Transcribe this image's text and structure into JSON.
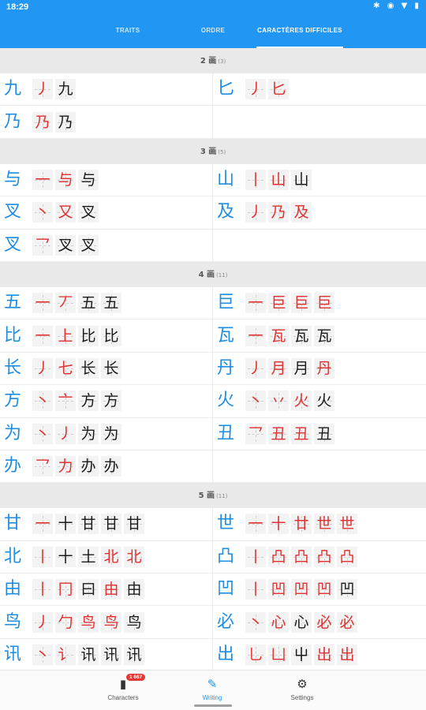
{
  "status": {
    "time": "18:29",
    "icons": "✱ ◉ ▼ ▮"
  },
  "tabs": [
    {
      "label": "TRAITS",
      "active": false
    },
    {
      "label": "ORDRE",
      "active": false
    },
    {
      "label": "CARACTÈRES DIFFICILES",
      "active": true
    }
  ],
  "sections": [
    {
      "title": "2 画",
      "count": "(3)",
      "rows": [
        [
          {
            "char": "九",
            "steps": [
              "丿",
              "九"
            ],
            "red": [
              0
            ]
          },
          {
            "char": "匕",
            "steps": [
              "丿",
              "匕"
            ],
            "red": [
              0,
              1
            ]
          }
        ],
        [
          {
            "char": "乃",
            "steps": [
              "乃",
              "乃"
            ],
            "red": [
              0
            ]
          },
          null
        ]
      ]
    },
    {
      "title": "3 画",
      "count": "(5)",
      "rows": [
        [
          {
            "char": "与",
            "steps": [
              "一",
              "与",
              "与"
            ],
            "red": [
              0,
              1
            ]
          },
          {
            "char": "山",
            "steps": [
              "丨",
              "山",
              "山"
            ],
            "red": [
              0,
              1
            ]
          }
        ],
        [
          {
            "char": "叉",
            "steps": [
              "丶",
              "又",
              "叉"
            ],
            "red": [
              0,
              1
            ]
          },
          {
            "char": "及",
            "steps": [
              "丿",
              "乃",
              "及"
            ],
            "red": [
              0,
              1,
              2
            ]
          }
        ],
        [
          {
            "char": "叉",
            "steps": [
              "乛",
              "叉",
              "叉"
            ],
            "red": [
              0
            ]
          },
          null
        ]
      ]
    },
    {
      "title": "4 画",
      "count": "(11)",
      "rows": [
        [
          {
            "char": "五",
            "steps": [
              "一",
              "丆",
              "五",
              "五"
            ],
            "red": [
              0,
              1
            ]
          },
          {
            "char": "巨",
            "steps": [
              "一",
              "巨",
              "巨",
              "巨"
            ],
            "red": [
              0,
              1,
              2,
              3
            ]
          }
        ],
        [
          {
            "char": "比",
            "steps": [
              "一",
              "上",
              "比",
              "比"
            ],
            "red": [
              0,
              1
            ]
          },
          {
            "char": "瓦",
            "steps": [
              "一",
              "瓦",
              "瓦",
              "瓦"
            ],
            "red": [
              0,
              1
            ]
          }
        ],
        [
          {
            "char": "长",
            "steps": [
              "丿",
              "七",
              "长",
              "长"
            ],
            "red": [
              0,
              1
            ]
          },
          {
            "char": "丹",
            "steps": [
              "丿",
              "月",
              "月",
              "丹"
            ],
            "red": [
              0,
              1,
              3
            ]
          }
        ],
        [
          {
            "char": "方",
            "steps": [
              "丶",
              "亠",
              "方",
              "方"
            ],
            "red": [
              0,
              1
            ]
          },
          {
            "char": "火",
            "steps": [
              "丶",
              "丷",
              "火",
              "火"
            ],
            "red": [
              0,
              1,
              2
            ]
          }
        ],
        [
          {
            "char": "为",
            "steps": [
              "丶",
              "丿",
              "为",
              "为"
            ],
            "red": [
              0,
              1
            ]
          },
          {
            "char": "丑",
            "steps": [
              "乛",
              "丑",
              "丑",
              "丑"
            ],
            "red": [
              0,
              1,
              2
            ]
          }
        ],
        [
          {
            "char": "办",
            "steps": [
              "乛",
              "力",
              "办",
              "办"
            ],
            "red": [
              0,
              1
            ]
          },
          null
        ]
      ]
    },
    {
      "title": "5 画",
      "count": "(11)",
      "rows": [
        [
          {
            "char": "甘",
            "steps": [
              "一",
              "十",
              "甘",
              "甘",
              "甘"
            ],
            "red": [
              0
            ]
          },
          {
            "char": "世",
            "steps": [
              "一",
              "十",
              "廿",
              "世",
              "世"
            ],
            "red": [
              0,
              1,
              2,
              3,
              4
            ]
          }
        ],
        [
          {
            "char": "北",
            "steps": [
              "丨",
              "十",
              "土",
              "北",
              "北"
            ],
            "red": [
              0,
              3,
              4
            ]
          },
          {
            "char": "凸",
            "steps": [
              "丨",
              "凸",
              "凸",
              "凸",
              "凸"
            ],
            "red": [
              0,
              1,
              2,
              3,
              4
            ]
          }
        ],
        [
          {
            "char": "由",
            "steps": [
              "丨",
              "冂",
              "曰",
              "由",
              "由"
            ],
            "red": [
              0,
              1,
              3
            ]
          },
          {
            "char": "凹",
            "steps": [
              "丨",
              "凹",
              "凹",
              "凹",
              "凹"
            ],
            "red": [
              0,
              1,
              2,
              3
            ]
          }
        ],
        [
          {
            "char": "鸟",
            "steps": [
              "丿",
              "勹",
              "鸟",
              "鸟",
              "鸟"
            ],
            "red": [
              0,
              1,
              2,
              3
            ]
          },
          {
            "char": "必",
            "steps": [
              "丶",
              "心",
              "心",
              "必",
              "必"
            ],
            "red": [
              0,
              1,
              3,
              4
            ]
          }
        ],
        [
          {
            "char": "讯",
            "steps": [
              "丶",
              "讠",
              "讯",
              "讯",
              "讯"
            ],
            "red": [
              0,
              1
            ]
          },
          {
            "char": "出",
            "steps": [
              "乚",
              "凵",
              "屮",
              "出",
              "出"
            ],
            "red": [
              0,
              1,
              3,
              4
            ]
          }
        ]
      ]
    }
  ],
  "bottom_nav": [
    {
      "label": "Characters",
      "icon": "book-icon",
      "badge": "1 667",
      "active": false
    },
    {
      "label": "Writing",
      "icon": "brush-icon",
      "active": true
    },
    {
      "label": "Settings",
      "icon": "gear-icon",
      "active": false
    }
  ],
  "colors": {
    "primary": "#2196f3",
    "character": "#1f8de0",
    "stroke_highlight": "#e03030"
  }
}
